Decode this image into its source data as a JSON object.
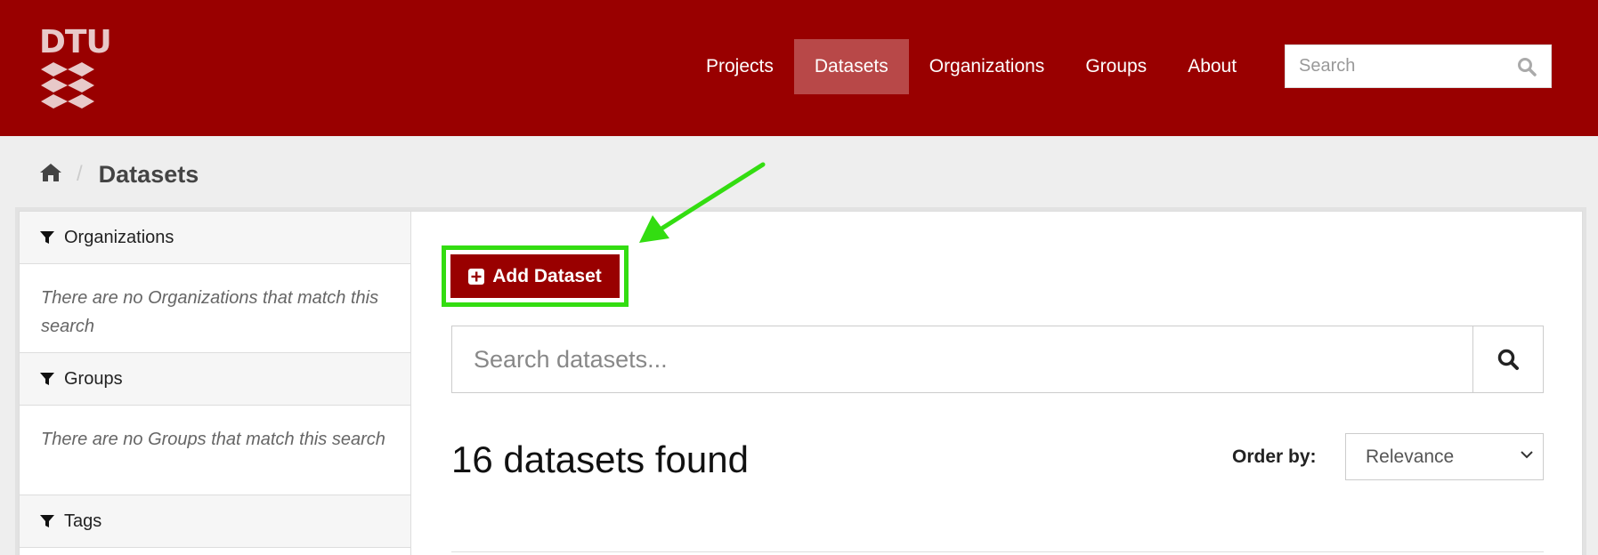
{
  "header": {
    "logo_text": "DTU",
    "nav": [
      {
        "label": "Projects",
        "active": false
      },
      {
        "label": "Datasets",
        "active": true
      },
      {
        "label": "Organizations",
        "active": false
      },
      {
        "label": "Groups",
        "active": false
      },
      {
        "label": "About",
        "active": false
      }
    ],
    "search_placeholder": "Search"
  },
  "breadcrumb": {
    "home_icon": "home-icon",
    "current": "Datasets"
  },
  "sidebar": {
    "facets": [
      {
        "title": "Organizations",
        "empty_text": "There are no Organizations that match this search"
      },
      {
        "title": "Groups",
        "empty_text": "There are no Groups that match this search"
      },
      {
        "title": "Tags",
        "empty_text": ""
      }
    ]
  },
  "main": {
    "add_button_label": "Add Dataset",
    "search_placeholder": "Search datasets...",
    "results_count": "16 datasets found",
    "order_label": "Order by:",
    "order_selected": "Relevance"
  },
  "colors": {
    "brand": "#990000",
    "nav_active": "#b84848",
    "annotation": "#33dd11"
  }
}
